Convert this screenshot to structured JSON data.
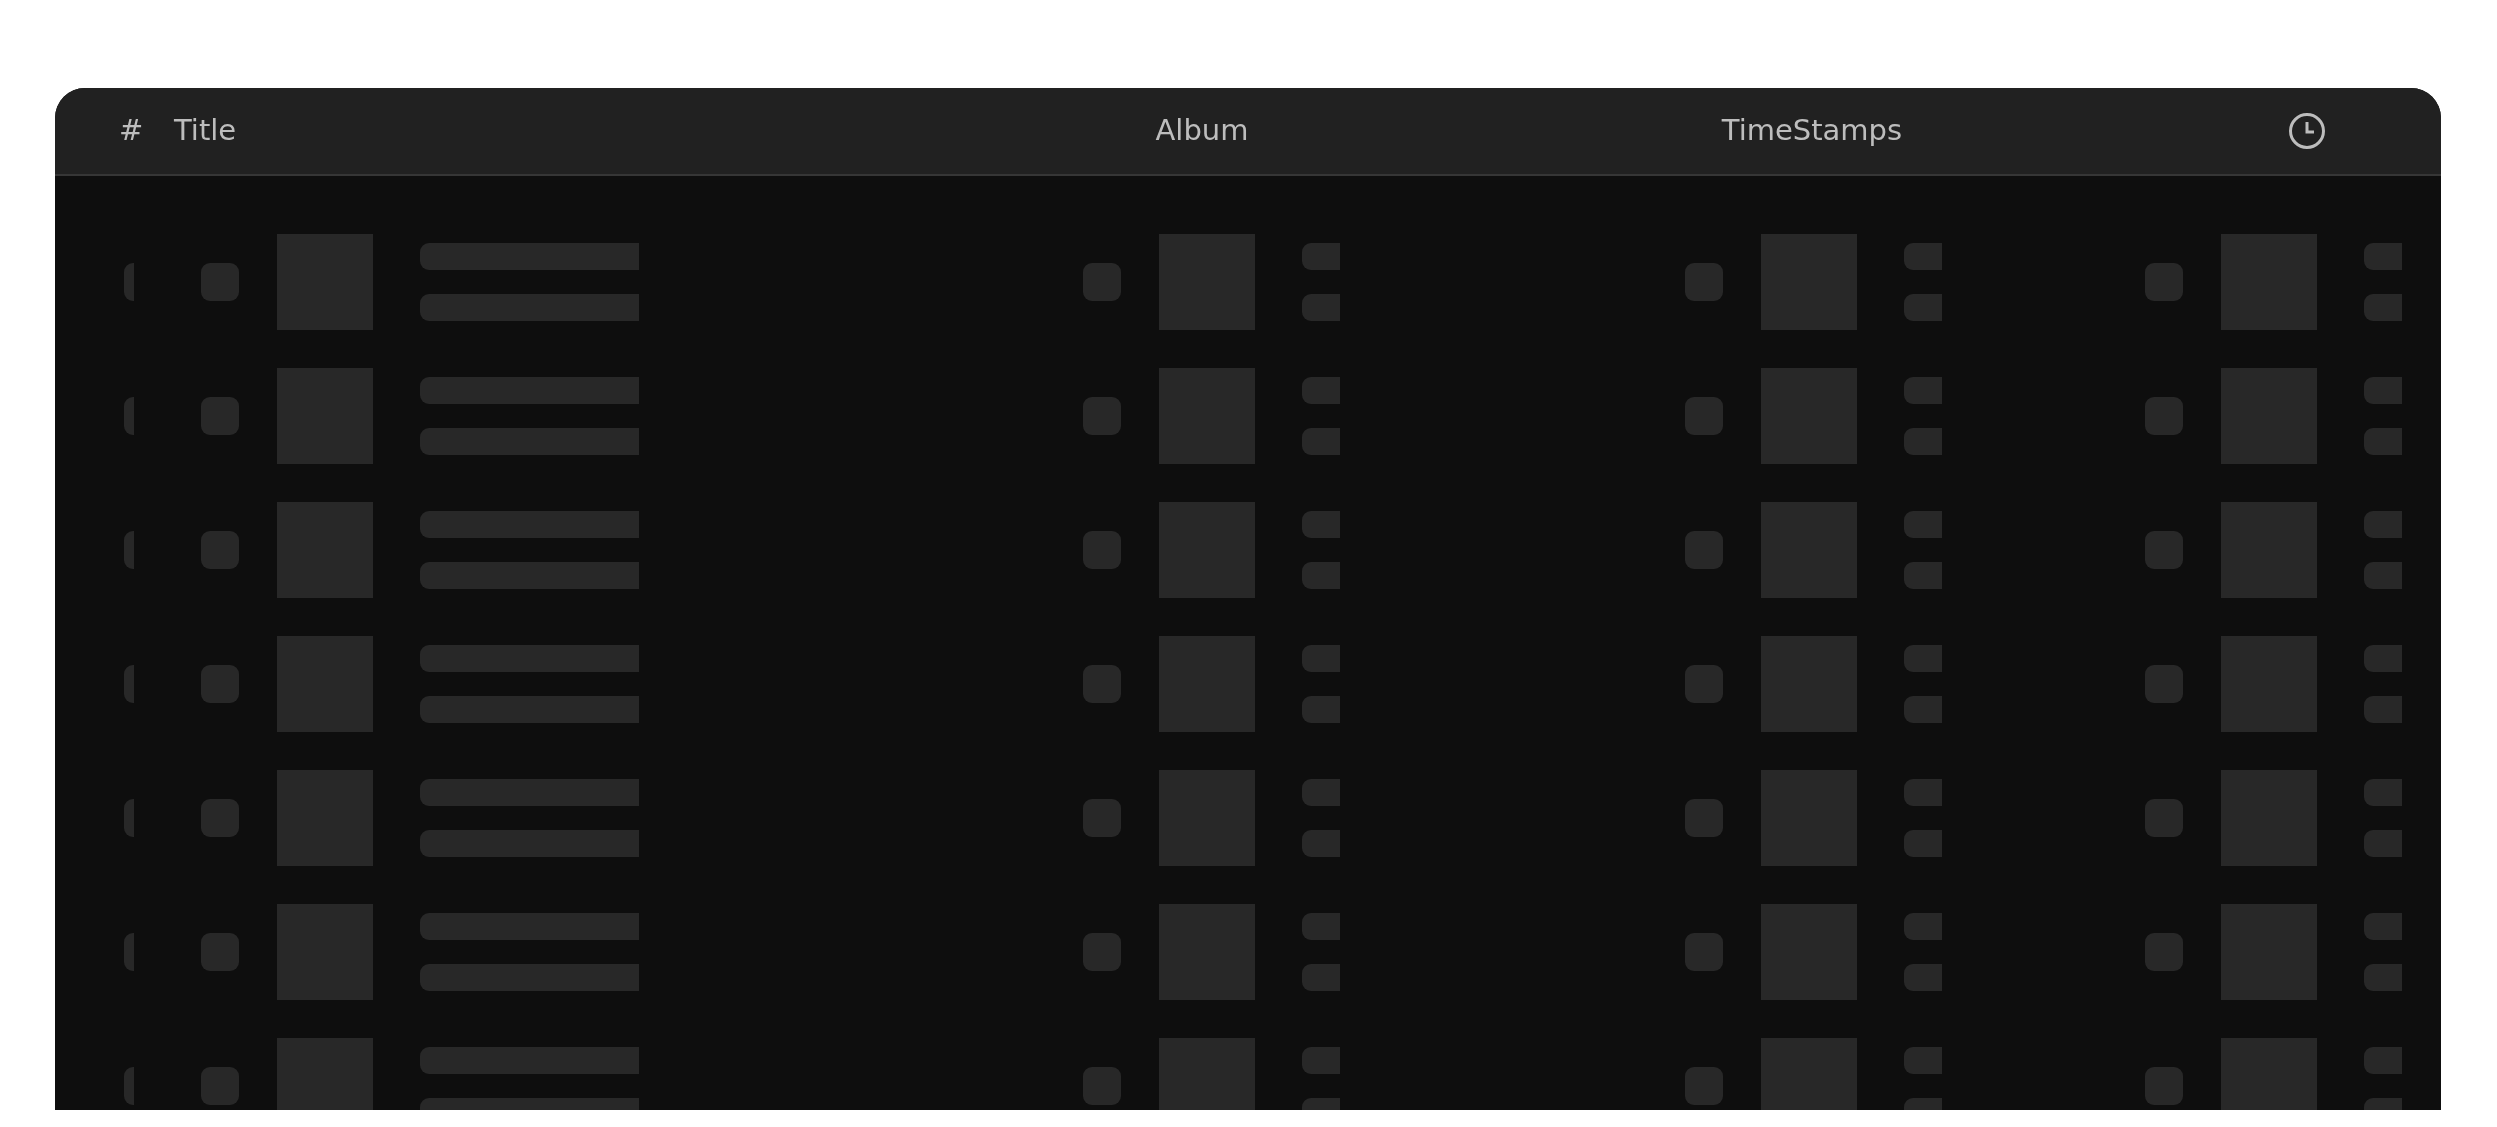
{
  "table": {
    "columns": [
      {
        "kind": "text",
        "label": "#"
      },
      {
        "kind": "text",
        "label": "Title"
      },
      {
        "kind": "text",
        "label": "Album"
      },
      {
        "kind": "text",
        "label": "TimeStamps"
      },
      {
        "kind": "icon"
      }
    ],
    "rows": [
      {
        "kind": "skeleton"
      },
      {
        "kind": "skeleton"
      },
      {
        "kind": "skeleton"
      },
      {
        "kind": "skeleton"
      },
      {
        "kind": "skeleton"
      },
      {
        "kind": "skeleton"
      },
      {
        "kind": "skeleton"
      }
    ]
  }
}
